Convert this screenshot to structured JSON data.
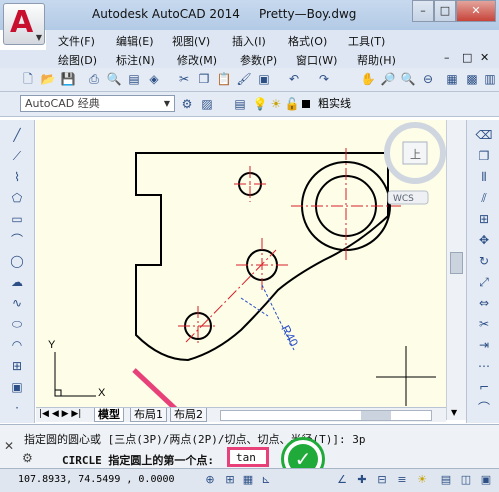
{
  "window": {
    "title": "Autodesk AutoCAD 2014",
    "filename": "Pretty—Boy.dwg",
    "app_logo": "A",
    "min_glyph": "–",
    "max_glyph": "□",
    "close_glyph": "✕"
  },
  "menubar": {
    "items": [
      "文件(F)",
      "编辑(E)",
      "视图(V)",
      "插入(I)",
      "格式(O)",
      "工具(T)",
      "绘图(D)",
      "标注(N)",
      "修改(M)",
      "参数(P)",
      "窗口(W)",
      "帮助(H)"
    ],
    "doc_min": "–",
    "doc_max": "□",
    "doc_close": "✕"
  },
  "workspace": {
    "selected": "AutoCAD 经典"
  },
  "layer_bar": {
    "current_linetype": "粗实线"
  },
  "viewcube": {
    "top_label": "上",
    "wcs_label": "WCS"
  },
  "drawing": {
    "dimension_text": "R40",
    "ucs_x": "X",
    "ucs_y": "Y"
  },
  "layout_tabs": [
    "模型",
    "布局1",
    "布局2"
  ],
  "command": {
    "history_line": "指定圆的圆心或 [三点(3P)/两点(2P)/切点、切点、半径(T)]: 3p",
    "prompt_label": "CIRCLE 指定圆上的第一个点:",
    "current_input": "tan",
    "close_glyph": "✕"
  },
  "status": {
    "coordinates": "107.8933, 74.5499 , 0.0000"
  },
  "colors": {
    "accent_pink": "#e8417a",
    "confirm_green": "#1faa3a",
    "canvas_bg": "#fdfde8",
    "centerline_red": "#d8202a",
    "dimension_blue": "#2a4fc7"
  }
}
